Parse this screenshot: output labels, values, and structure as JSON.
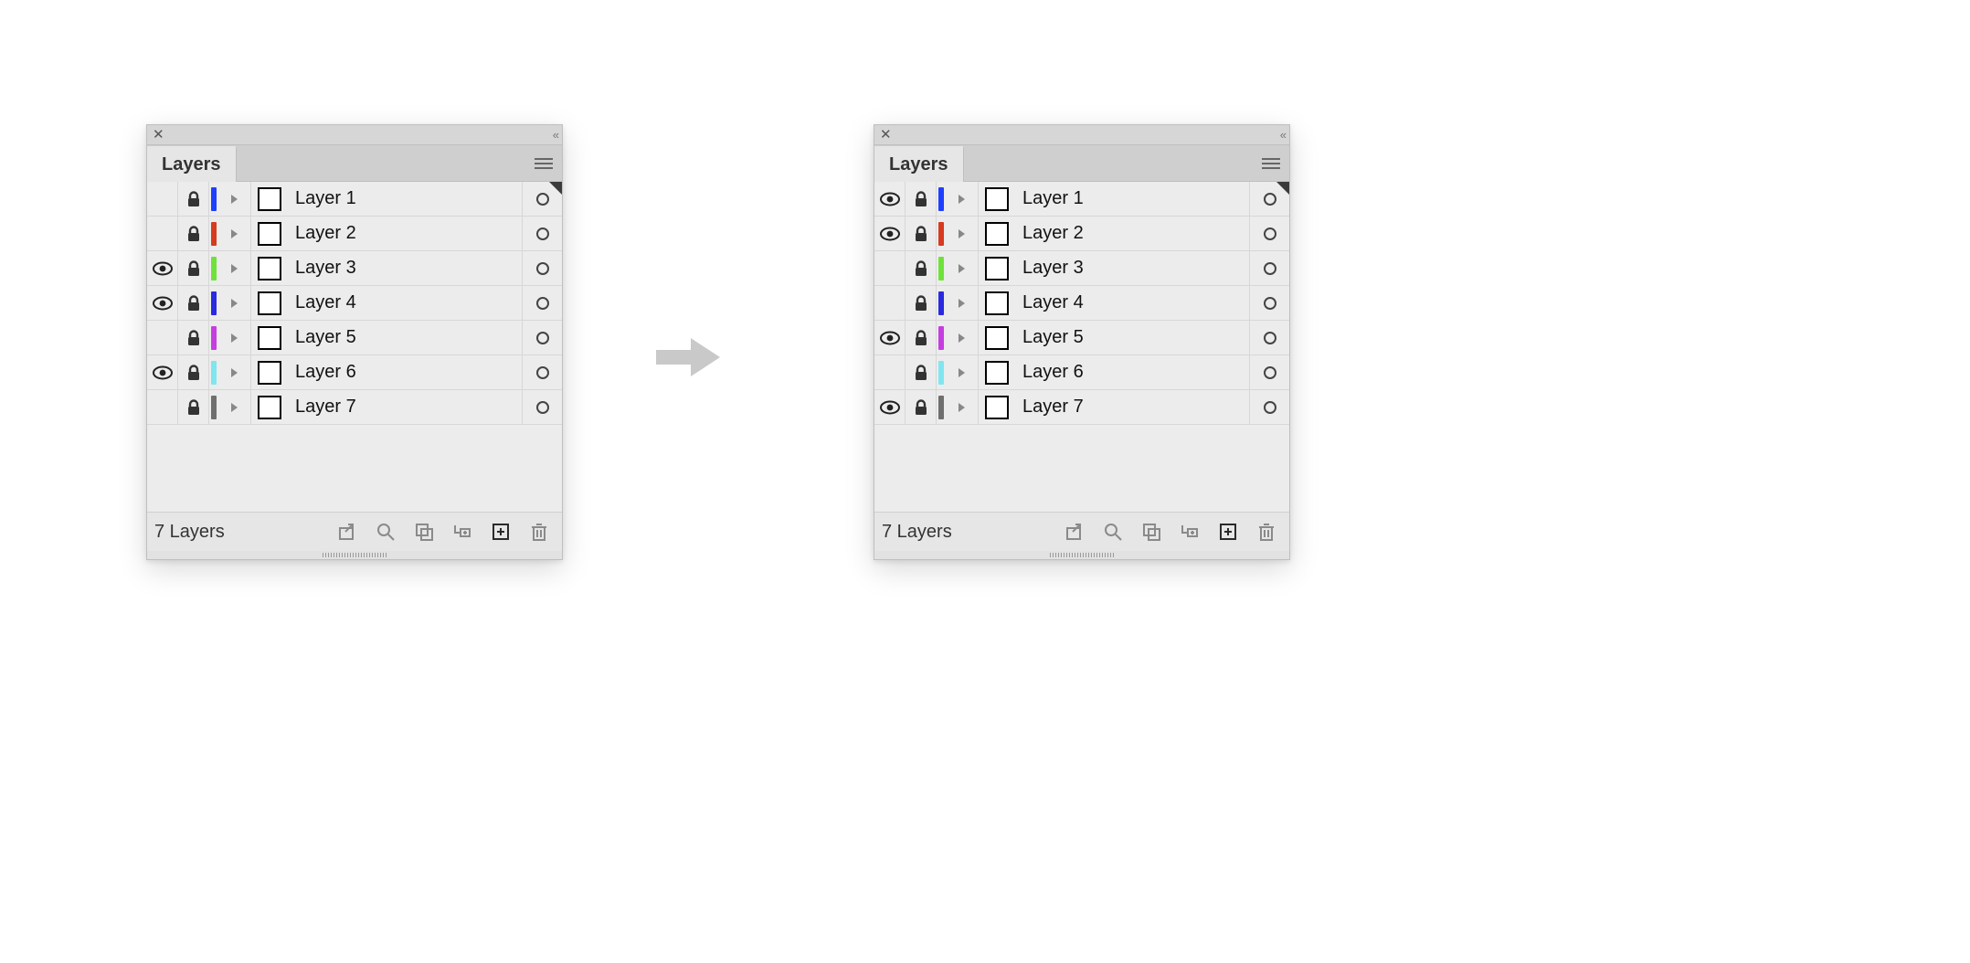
{
  "tab_label": "Layers",
  "footer_count": "7 Layers",
  "close_glyph": "✕",
  "collapse_glyph": "«",
  "layer_colors": [
    "#1f3fff",
    "#d63a1f",
    "#6fe23a",
    "#2a2adf",
    "#c53fe0",
    "#7fe6ef",
    "#6f6f6f"
  ],
  "panels": [
    {
      "id": "before",
      "layers": [
        {
          "name": "Layer 1",
          "visible": false,
          "locked": true,
          "color": 0
        },
        {
          "name": "Layer 2",
          "visible": false,
          "locked": true,
          "color": 1
        },
        {
          "name": "Layer 3",
          "visible": true,
          "locked": true,
          "color": 2
        },
        {
          "name": "Layer 4",
          "visible": true,
          "locked": true,
          "color": 3
        },
        {
          "name": "Layer 5",
          "visible": false,
          "locked": true,
          "color": 4
        },
        {
          "name": "Layer 6",
          "visible": true,
          "locked": true,
          "color": 5
        },
        {
          "name": "Layer 7",
          "visible": false,
          "locked": true,
          "color": 6
        }
      ]
    },
    {
      "id": "after",
      "layers": [
        {
          "name": "Layer 1",
          "visible": true,
          "locked": true,
          "color": 0
        },
        {
          "name": "Layer 2",
          "visible": true,
          "locked": true,
          "color": 1
        },
        {
          "name": "Layer 3",
          "visible": false,
          "locked": true,
          "color": 2
        },
        {
          "name": "Layer 4",
          "visible": false,
          "locked": true,
          "color": 3
        },
        {
          "name": "Layer 5",
          "visible": true,
          "locked": true,
          "color": 4
        },
        {
          "name": "Layer 6",
          "visible": false,
          "locked": true,
          "color": 5
        },
        {
          "name": "Layer 7",
          "visible": true,
          "locked": true,
          "color": 6
        }
      ]
    }
  ],
  "footer_icons": [
    {
      "name": "collect-for-export-icon",
      "enabled": false
    },
    {
      "name": "locate-object-icon",
      "enabled": false
    },
    {
      "name": "clipping-mask-icon",
      "enabled": false
    },
    {
      "name": "new-sublayer-icon",
      "enabled": false
    },
    {
      "name": "new-layer-icon",
      "enabled": true
    },
    {
      "name": "delete-layer-icon",
      "enabled": false
    }
  ]
}
